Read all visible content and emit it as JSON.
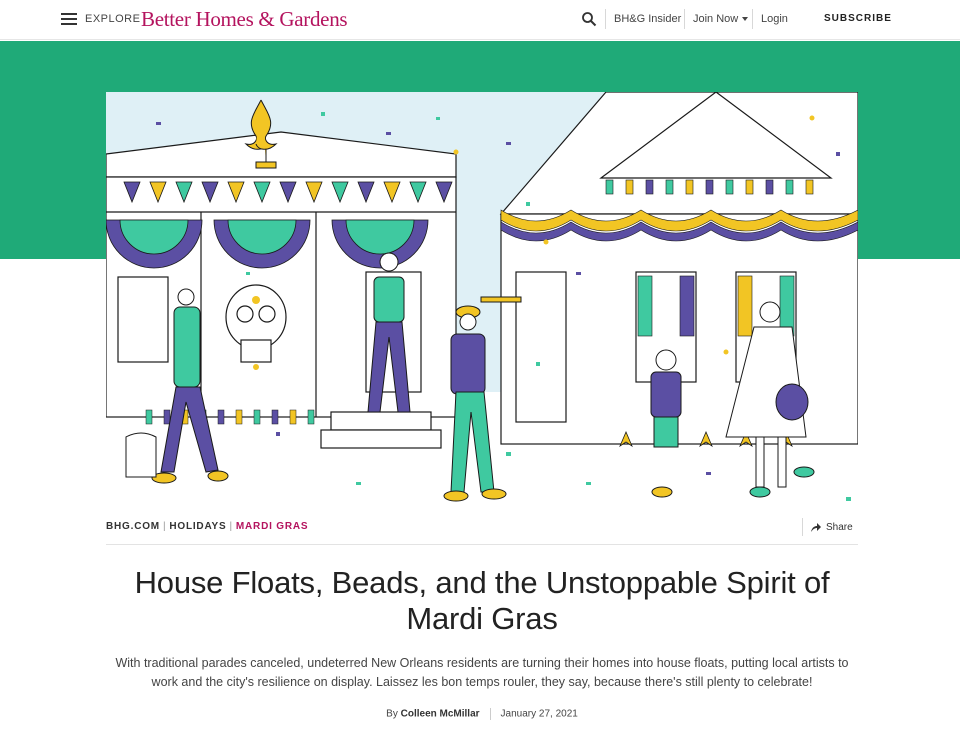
{
  "header": {
    "explore_label": "EXPLORE",
    "logo_text": "Better Homes & Gardens",
    "nav": {
      "insider": "BH&G Insider",
      "join": "Join Now",
      "login": "Login",
      "subscribe": "SUBSCRIBE"
    }
  },
  "colors": {
    "brand": "#b4135e",
    "band": "#1faa78",
    "mardi_purple": "#5b4fa3",
    "mardi_green": "#3fc9a0",
    "mardi_gold": "#f2c524"
  },
  "hero": {
    "image_alt": "Illustration of decorated New Orleans houses and costumed residents celebrating Mardi Gras"
  },
  "breadcrumb": {
    "site": "BHG.COM",
    "section": "HOLIDAYS",
    "topic": "MARDI GRAS",
    "share": "Share"
  },
  "article": {
    "title": "House Floats, Beads, and the Unstoppable Spirit of Mardi Gras",
    "dek": "With traditional parades canceled, undeterred New Orleans residents are turning their homes into house floats, putting local artists to work and the city's resilience on display. Laissez les bon temps rouler, they say, because there's still plenty to celebrate!",
    "by_prefix": "By",
    "author": "Colleen McMillar",
    "date": "January 27, 2021"
  }
}
